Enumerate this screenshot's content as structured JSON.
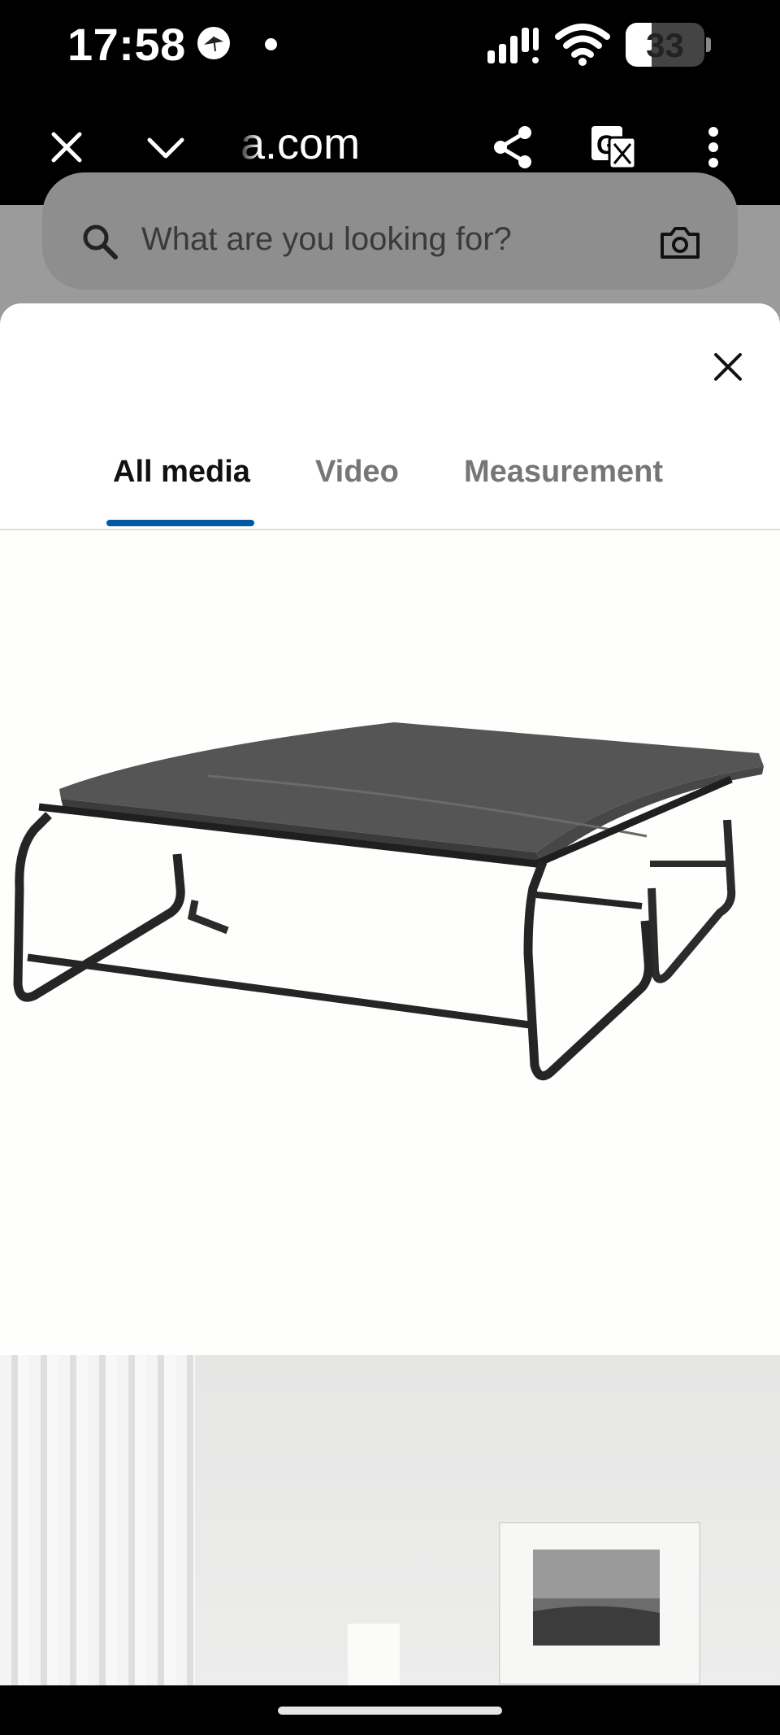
{
  "status_bar": {
    "time": "17:58",
    "battery_level": "33",
    "icons": [
      "app-badge-icon",
      "notification-dot-icon",
      "signal-icon",
      "wifi-icon",
      "battery-icon"
    ]
  },
  "browser_toolbar": {
    "url": "a.com",
    "icons": [
      "close-icon",
      "chevron-down-icon",
      "share-icon",
      "translate-icon",
      "more-vert-icon"
    ]
  },
  "search": {
    "placeholder": "What are you looking for?",
    "icons": [
      "search-icon",
      "camera-icon"
    ]
  },
  "media_sheet": {
    "tabs": [
      {
        "label": "All media",
        "active": true
      },
      {
        "label": "Video",
        "active": false
      },
      {
        "label": "Measurement",
        "active": false
      }
    ],
    "accent_color": "#0058a3",
    "items": [
      "folding bed product image",
      "bedroom room scene image"
    ]
  }
}
